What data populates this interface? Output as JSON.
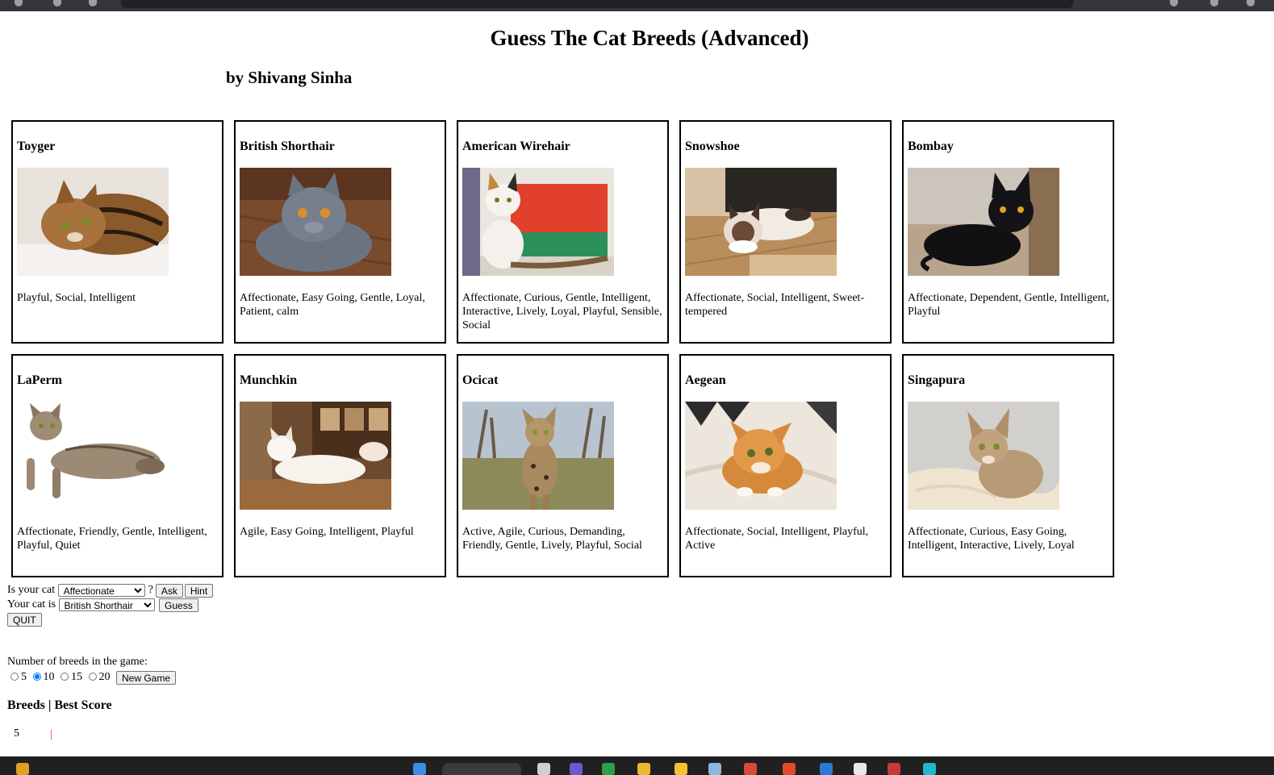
{
  "header": {
    "title": "Guess The Cat Breeds (Advanced)",
    "subtitle": "by Shivang Sinha"
  },
  "cards": [
    {
      "name": "Toyger",
      "traits": "Playful, Social, Intelligent",
      "photo": "tabby-cat-lying-photo"
    },
    {
      "name": "British Shorthair",
      "traits": "Affectionate, Easy Going, Gentle, Loyal, Patient, calm",
      "photo": "grey-cat-on-floor-photo"
    },
    {
      "name": "American Wirehair",
      "traits": "Affectionate, Curious, Gentle, Intelligent, Interactive, Lively, Loyal, Playful, Sensible, Social",
      "photo": "calico-cat-sitting-photo"
    },
    {
      "name": "Snowshoe",
      "traits": "Affectionate, Social, Intelligent, Sweet-tempered",
      "photo": "siamese-cat-on-floor-photo"
    },
    {
      "name": "Bombay",
      "traits": "Affectionate, Dependent, Gentle, Intelligent, Playful",
      "photo": "black-cat-photo"
    },
    {
      "name": "LaPerm",
      "traits": "Affectionate, Friendly, Gentle, Intelligent, Playful, Quiet",
      "photo": "curly-tabby-cat-photo"
    },
    {
      "name": "Munchkin",
      "traits": "Agile, Easy Going, Intelligent, Playful",
      "photo": "white-cat-on-table-photo"
    },
    {
      "name": "Ocicat",
      "traits": "Active, Agile, Curious, Demanding, Friendly, Gentle, Lively, Playful, Social",
      "photo": "spotted-cat-walking-photo"
    },
    {
      "name": "Aegean",
      "traits": "Affectionate, Social, Intelligent, Playful, Active",
      "photo": "orange-cat-on-bed-photo"
    },
    {
      "name": "Singapura",
      "traits": "Affectionate, Curious, Easy Going, Intelligent, Interactive, Lively, Loyal",
      "photo": "ticked-cat-on-blanket-photo"
    }
  ],
  "controls": {
    "ask_prefix": "Is your cat",
    "trait_selected": "Affectionate",
    "ask_suffix": "?",
    "ask_label": "Ask",
    "hint_label": "Hint",
    "guess_prefix": "Your cat is",
    "breed_selected": "British Shorthair",
    "guess_label": "Guess",
    "quit_label": "QUIT",
    "count_label": "Number of breeds in the game:",
    "count_options": [
      "5",
      "10",
      "15",
      "20"
    ],
    "count_selected": "10",
    "new_game_label": "New Game"
  },
  "scores": {
    "header": "Breeds | Best Score",
    "rows": [
      {
        "breeds": "5"
      }
    ]
  },
  "colors": {
    "browser_bar": "#35363a",
    "taskbar": "#202020",
    "card_border": "#000000",
    "score_mark": "#e46b8f"
  }
}
